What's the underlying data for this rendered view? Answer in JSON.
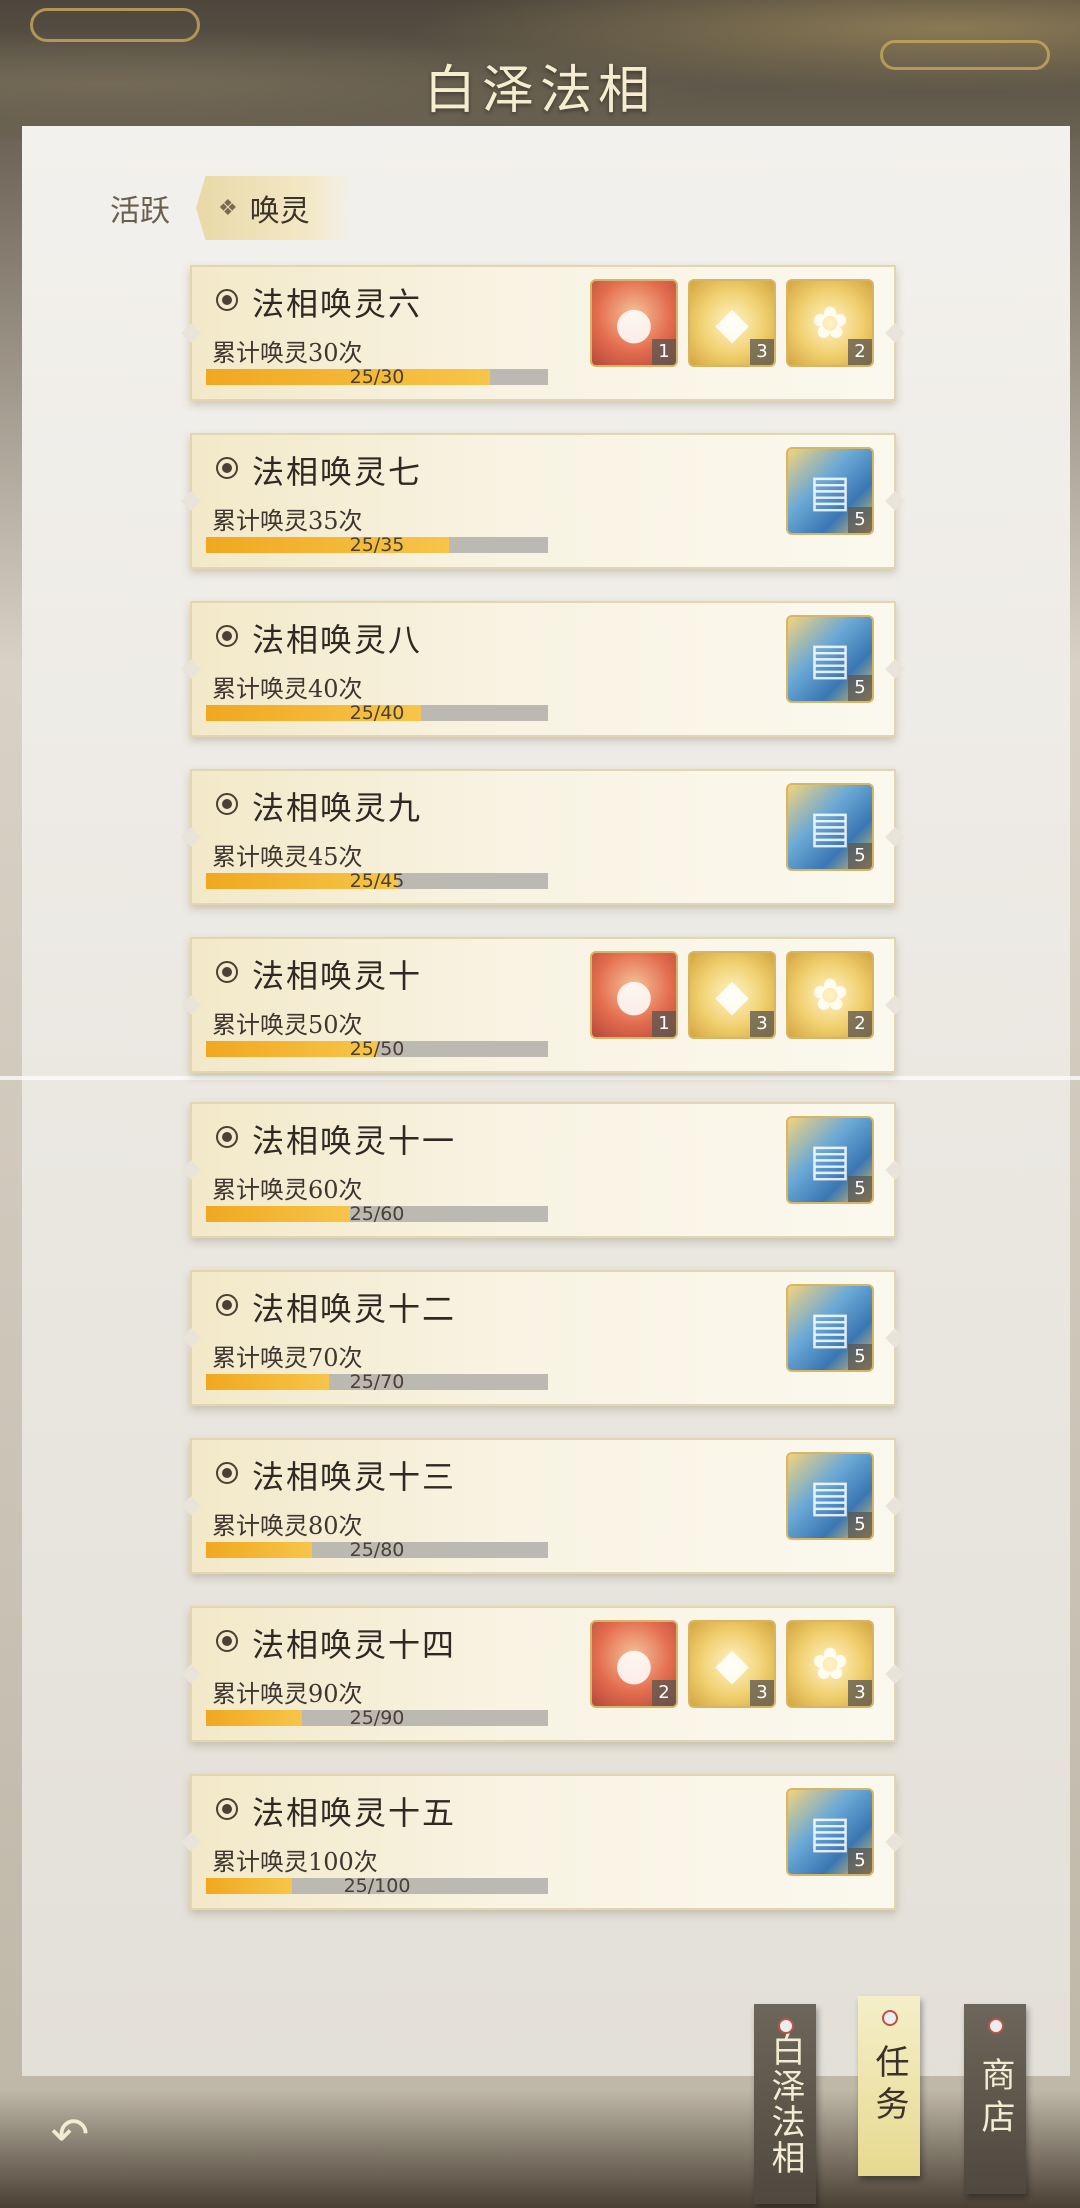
{
  "header": {
    "title": "白泽法相"
  },
  "tabs": {
    "inactive_label": "活跃",
    "active_label": "唤灵"
  },
  "tasks": [
    {
      "name": "法相唤灵六",
      "desc": "累计唤灵30次",
      "progress": "25/30",
      "fraction": 0.833,
      "rewards": [
        {
          "icon": "red-orb-icon",
          "kind": "red",
          "glyph": "●",
          "count": "1"
        },
        {
          "icon": "character-portrait-icon",
          "kind": "gold",
          "glyph": "◆",
          "count": "3"
        },
        {
          "icon": "lotus-icon",
          "kind": "gold",
          "glyph": "✿",
          "count": "2"
        }
      ]
    },
    {
      "name": "法相唤灵七",
      "desc": "累计唤灵35次",
      "progress": "25/35",
      "fraction": 0.714,
      "rewards": [
        {
          "icon": "card-pack-icon",
          "kind": "blue",
          "glyph": "▤",
          "count": "5"
        }
      ]
    },
    {
      "name": "法相唤灵八",
      "desc": "累计唤灵40次",
      "progress": "25/40",
      "fraction": 0.625,
      "rewards": [
        {
          "icon": "card-pack-icon",
          "kind": "blue",
          "glyph": "▤",
          "count": "5"
        }
      ]
    },
    {
      "name": "法相唤灵九",
      "desc": "累计唤灵45次",
      "progress": "25/45",
      "fraction": 0.556,
      "rewards": [
        {
          "icon": "card-pack-icon",
          "kind": "blue",
          "glyph": "▤",
          "count": "5"
        }
      ]
    },
    {
      "name": "法相唤灵十",
      "desc": "累计唤灵50次",
      "progress": "25/50",
      "fraction": 0.5,
      "rewards": [
        {
          "icon": "red-orb-icon",
          "kind": "red",
          "glyph": "●",
          "count": "1"
        },
        {
          "icon": "character-portrait-icon",
          "kind": "gold",
          "glyph": "◆",
          "count": "3"
        },
        {
          "icon": "lotus-icon",
          "kind": "gold",
          "glyph": "✿",
          "count": "2"
        }
      ]
    },
    {
      "name": "法相唤灵十一",
      "desc": "累计唤灵60次",
      "progress": "25/60",
      "fraction": 0.417,
      "rewards": [
        {
          "icon": "card-pack-icon",
          "kind": "blue",
          "glyph": "▤",
          "count": "5"
        }
      ]
    },
    {
      "name": "法相唤灵十二",
      "desc": "累计唤灵70次",
      "progress": "25/70",
      "fraction": 0.357,
      "rewards": [
        {
          "icon": "card-pack-icon",
          "kind": "blue",
          "glyph": "▤",
          "count": "5"
        }
      ]
    },
    {
      "name": "法相唤灵十三",
      "desc": "累计唤灵80次",
      "progress": "25/80",
      "fraction": 0.313,
      "rewards": [
        {
          "icon": "card-pack-icon",
          "kind": "blue",
          "glyph": "▤",
          "count": "5"
        }
      ]
    },
    {
      "name": "法相唤灵十四",
      "desc": "累计唤灵90次",
      "progress": "25/90",
      "fraction": 0.278,
      "rewards": [
        {
          "icon": "red-orb-icon",
          "kind": "red",
          "glyph": "●",
          "count": "2"
        },
        {
          "icon": "character-portrait-icon",
          "kind": "gold",
          "glyph": "◆",
          "count": "3"
        },
        {
          "icon": "lotus-icon",
          "kind": "gold",
          "glyph": "✿",
          "count": "3"
        }
      ]
    },
    {
      "name": "法相唤灵十五",
      "desc": "累计唤灵100次",
      "progress": "25/100",
      "fraction": 0.25,
      "rewards": [
        {
          "icon": "card-pack-icon",
          "kind": "blue",
          "glyph": "▤",
          "count": "5"
        }
      ]
    }
  ],
  "side_tags": [
    {
      "label": "白泽法相",
      "style": "dark"
    },
    {
      "label": "任务",
      "style": "light"
    },
    {
      "label": "商店",
      "style": "dark"
    }
  ],
  "footer": {
    "back_icon": "back-arrow-icon"
  }
}
